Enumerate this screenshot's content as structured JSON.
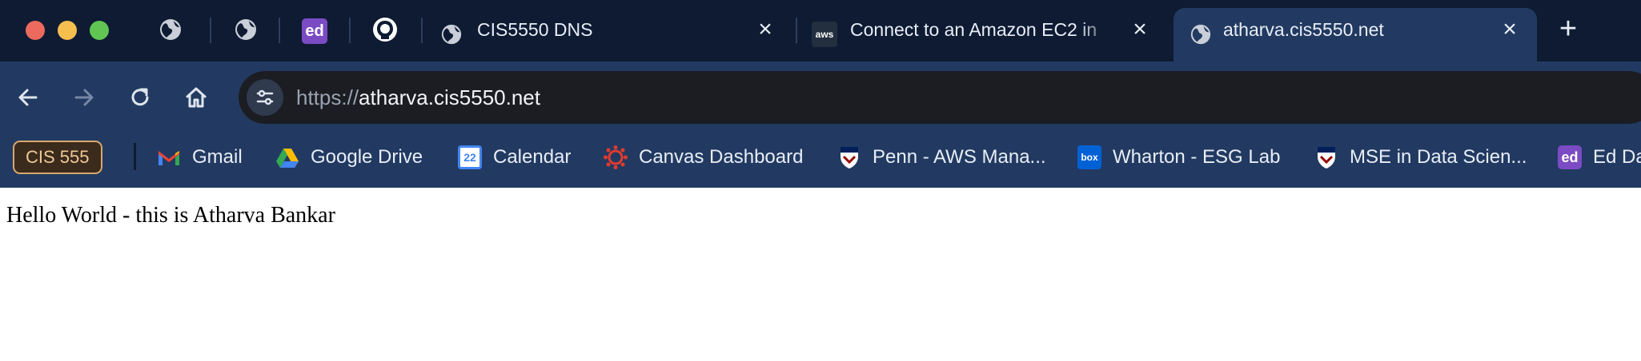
{
  "window_controls": [
    "close",
    "minimize",
    "maximize"
  ],
  "pinned_tabs": [
    {
      "icon": "globe-icon"
    },
    {
      "icon": "globe-icon"
    },
    {
      "icon": "ed-icon",
      "text": "ed"
    },
    {
      "icon": "github-icon"
    }
  ],
  "tabs": [
    {
      "title": "CIS5550 DNS",
      "icon": "globe-icon",
      "active": false
    },
    {
      "title": "Connect to an Amazon EC2 in",
      "icon": "aws-icon",
      "icon_text": "aws",
      "active": false
    },
    {
      "title": "atharva.cis5550.net",
      "icon": "globe-icon",
      "active": true
    }
  ],
  "omnibox": {
    "scheme": "https://",
    "host": "atharva.cis5550.net"
  },
  "bookmarks": {
    "group_label": "CIS 555",
    "items": [
      {
        "label": "Gmail",
        "icon": "gmail-icon"
      },
      {
        "label": "Google Drive",
        "icon": "google-drive-icon"
      },
      {
        "label": "Calendar",
        "icon": "calendar-icon",
        "icon_text": "22"
      },
      {
        "label": "Canvas Dashboard",
        "icon": "canvas-icon"
      },
      {
        "label": "Penn - AWS Mana...",
        "icon": "penn-shield-icon"
      },
      {
        "label": "Wharton - ESG Lab",
        "icon": "box-icon",
        "icon_text": "box"
      },
      {
        "label": "MSE in Data Scien...",
        "icon": "penn-shield-icon"
      },
      {
        "label": "Ed Da",
        "icon": "ed-icon",
        "icon_text": "ed"
      }
    ]
  },
  "page": {
    "text": "Hello World - this is Atharva Bankar"
  },
  "colors": {
    "tabbar": "#0e1b33",
    "toolbar": "#223a61",
    "omnibox": "#1b1d22",
    "group_accent": "#d9a86c",
    "ed_purple": "#7b4bc4"
  }
}
